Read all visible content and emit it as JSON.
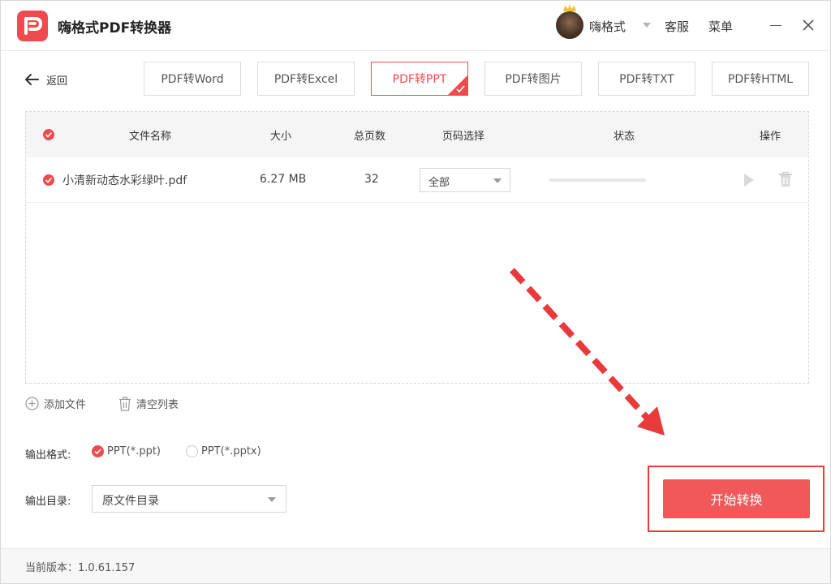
{
  "app": {
    "title": "嗨格式PDF转换器"
  },
  "header": {
    "username": "嗨格式",
    "service": "客服",
    "menu": "菜单"
  },
  "nav": {
    "back_label": "返回"
  },
  "tabs": [
    {
      "label": "PDF转Word",
      "active": false
    },
    {
      "label": "PDF转Excel",
      "active": false
    },
    {
      "label": "PDF转PPT",
      "active": true
    },
    {
      "label": "PDF转图片",
      "active": false
    },
    {
      "label": "PDF转TXT",
      "active": false
    },
    {
      "label": "PDF转HTML",
      "active": false
    }
  ],
  "table": {
    "headers": {
      "name": "文件名称",
      "size": "大小",
      "pages": "总页数",
      "page_select": "页码选择",
      "status": "状态",
      "actions": "操作"
    },
    "rows": [
      {
        "name": "小清新动态水彩绿叶.pdf",
        "size": "6.27 MB",
        "pages": "32",
        "page_select": "全部",
        "progress": 0
      }
    ]
  },
  "actions": {
    "add_file": "添加文件",
    "clear_list": "清空列表"
  },
  "output": {
    "format_label": "输出格式:",
    "formats": [
      {
        "label": "PPT(*.ppt)",
        "selected": true
      },
      {
        "label": "PPT(*.pptx)",
        "selected": false
      }
    ],
    "dir_label": "输出目录:",
    "dir_value": "原文件目录"
  },
  "start_button": "开始转换",
  "footer": {
    "version": "当前版本：1.0.61.157"
  },
  "colors": {
    "accent": "#ef4b4f",
    "annotation": "#ea3b3b"
  }
}
